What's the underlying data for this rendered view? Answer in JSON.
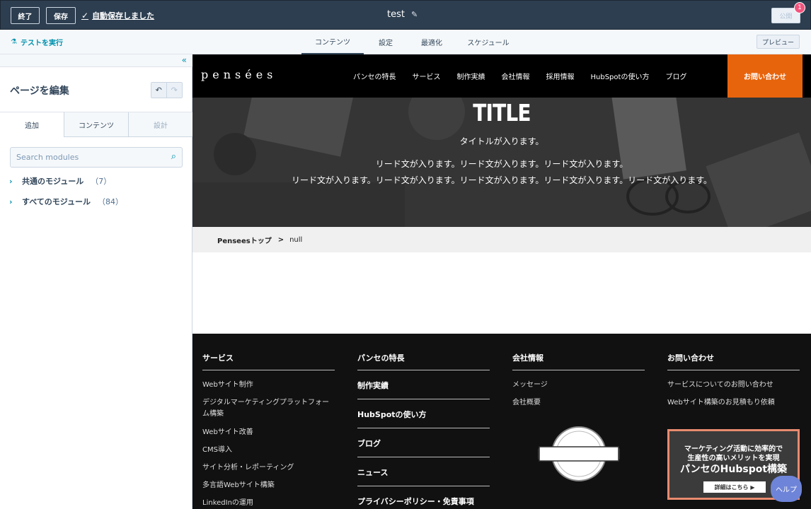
{
  "topbar": {
    "exit_label": "終了",
    "save_label": "保存",
    "autosave_text": "自動保存しました",
    "page_name": "test",
    "publish_label": "公開",
    "notification_count": "1"
  },
  "navbar": {
    "test_run_label": "テストを実行",
    "tabs": [
      {
        "label": "コンテンツ",
        "active": true
      },
      {
        "label": "設定"
      },
      {
        "label": "最適化"
      },
      {
        "label": "スケジュール"
      }
    ],
    "preview_label": "プレビュー"
  },
  "panel": {
    "title": "ページを編集",
    "tabs": [
      {
        "label": "追加"
      },
      {
        "label": "コンテンツ"
      },
      {
        "label": "設計"
      }
    ],
    "search_placeholder": "Search modules",
    "module_groups": [
      {
        "name": "共通のモジュール",
        "count": "（7）"
      },
      {
        "name": "すべてのモジュール",
        "count": "（84）"
      }
    ]
  },
  "site": {
    "logo": "pensées",
    "nav": [
      "パンセの特長",
      "サービス",
      "制作実績",
      "会社情報",
      "採用情報",
      "HubSpotの使い方",
      "ブログ"
    ],
    "contact_label": "お問い合わせ",
    "hero": {
      "title": "TITLE",
      "subtitle": "タイトルが入ります。",
      "lead1": "リード文が入ります。リード文が入ります。リード文が入ります。",
      "lead2": "リード文が入ります。リード文が入ります。リード文が入ります。リード文が入ります。リード文が入ります。"
    },
    "breadcrumb": {
      "home": "Penseesトップ",
      "separator": ">",
      "current": "null"
    },
    "footer": {
      "col1": {
        "heading": "サービス",
        "items": [
          "Webサイト制作",
          "デジタルマーケティングプラットフォーム構築",
          "Webサイト改善",
          "CMS導入",
          "サイト分析・レポーティング",
          "多言語Webサイト構築",
          "LinkedInの運用"
        ]
      },
      "col2": {
        "heading": "パンセの特長",
        "items": [
          "制作実績",
          "HubSpotの使い方",
          "ブログ",
          "ニュース",
          "プライバシーポリシー・免責事項"
        ]
      },
      "col3": {
        "heading": "会社情報",
        "items": [
          "メッセージ",
          "会社概要"
        ]
      },
      "col4": {
        "heading": "お問い合わせ",
        "items": [
          "サービスについてのお問い合わせ",
          "Webサイト構築のお見積もり依頼"
        ]
      },
      "banner": {
        "line1": "マーケティング活動に効率的で",
        "line2": "生産性の高いメリットを実現",
        "line3": "パンセのHubspot構築",
        "button": "詳細はこちら ▶"
      }
    }
  },
  "help_label": "ヘルプ",
  "colors": {
    "topbar_bg": "#2d3e50",
    "accent": "#0091ae",
    "contact_orange": "#e8640c",
    "notification_pink": "#f2547d",
    "help_blue": "#6e84d8"
  }
}
